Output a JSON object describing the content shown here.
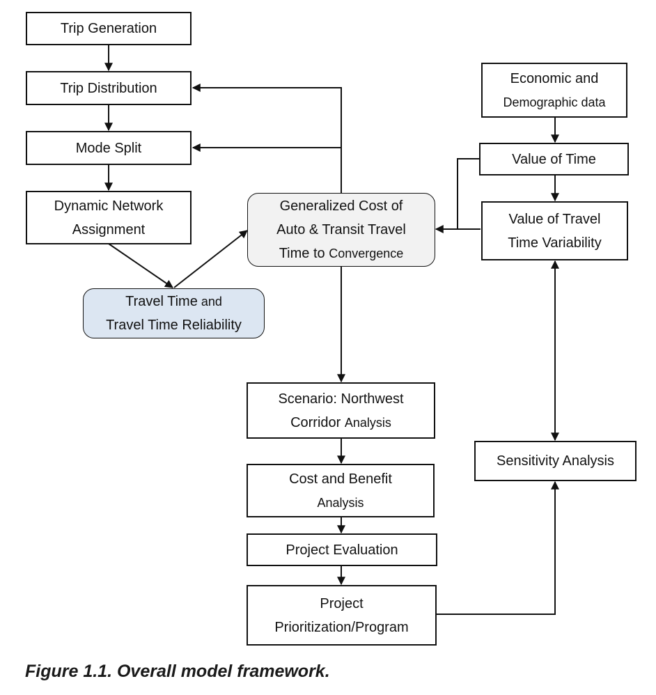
{
  "figure": {
    "caption": "Figure 1.1.  Overall model framework."
  },
  "colors": {
    "line": "#111111",
    "generalized_cost_fill": "#f2f2f2",
    "travel_time_fill": "#dce6f2"
  },
  "nodes": {
    "trip_generation": {
      "line1": "Trip Generation"
    },
    "trip_distribution": {
      "line1": "Trip Distribution"
    },
    "mode_split": {
      "line1": "Mode Split"
    },
    "dynamic_network_assignment": {
      "line1": "Dynamic Network",
      "line2": "Assignment"
    },
    "travel_time_reliability": {
      "line1a": "Travel Time",
      "line1b": " and",
      "line2": "Travel Time Reliability"
    },
    "generalized_cost": {
      "line1": "Generalized Cost of",
      "line2": "Auto & Transit Travel",
      "line3a": "Time to ",
      "line3b": "Convergence"
    },
    "economic_data": {
      "line1": "Economic and",
      "line2": "Demographic data"
    },
    "value_of_time": {
      "line1": "Value of Time"
    },
    "value_of_tt_variability": {
      "line1": "Value of Travel",
      "line2": "Time Variability"
    },
    "scenario": {
      "line1": "Scenario: Northwest",
      "line2a": "Corridor ",
      "line2b": "Analysis"
    },
    "cost_benefit": {
      "line1": "Cost and Benefit",
      "line2": "Analysis"
    },
    "project_evaluation": {
      "line1": "Project Evaluation"
    },
    "project_prioritization": {
      "line1": "Project",
      "line2": "Prioritization/Program"
    },
    "sensitivity_analysis": {
      "line1": "Sensitivity Analysis"
    }
  },
  "edges": [
    {
      "from": "trip_generation",
      "to": "trip_distribution"
    },
    {
      "from": "trip_distribution",
      "to": "mode_split"
    },
    {
      "from": "mode_split",
      "to": "dynamic_network_assignment"
    },
    {
      "from": "dynamic_network_assignment",
      "to": "travel_time_reliability"
    },
    {
      "from": "travel_time_reliability",
      "to": "generalized_cost"
    },
    {
      "from": "generalized_cost",
      "to": "trip_distribution"
    },
    {
      "from": "generalized_cost",
      "to": "mode_split"
    },
    {
      "from": "generalized_cost",
      "to": "scenario"
    },
    {
      "from": "economic_data",
      "to": "value_of_time"
    },
    {
      "from": "value_of_time",
      "to": "value_of_tt_variability"
    },
    {
      "from": "value_of_time",
      "to": "generalized_cost"
    },
    {
      "from": "value_of_tt_variability",
      "to": "generalized_cost"
    },
    {
      "from": "value_of_tt_variability",
      "to": "sensitivity_analysis",
      "bidirectional": true
    },
    {
      "from": "scenario",
      "to": "cost_benefit"
    },
    {
      "from": "cost_benefit",
      "to": "project_evaluation"
    },
    {
      "from": "project_evaluation",
      "to": "project_prioritization"
    },
    {
      "from": "project_prioritization",
      "to": "sensitivity_analysis"
    }
  ]
}
